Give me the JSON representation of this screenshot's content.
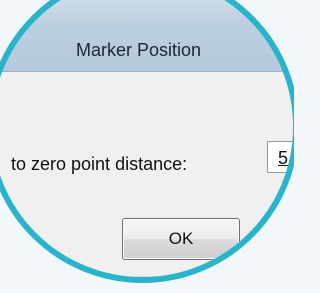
{
  "dialog": {
    "title": "Marker Position",
    "field_label": "to zero point distance:",
    "field_value": "5",
    "ok_label": "OK"
  },
  "colors": {
    "ring": "#29b4cc",
    "background": "#f2f7fb",
    "titlebar": "#bccfdf",
    "dialog_face": "#f0f0f0"
  }
}
